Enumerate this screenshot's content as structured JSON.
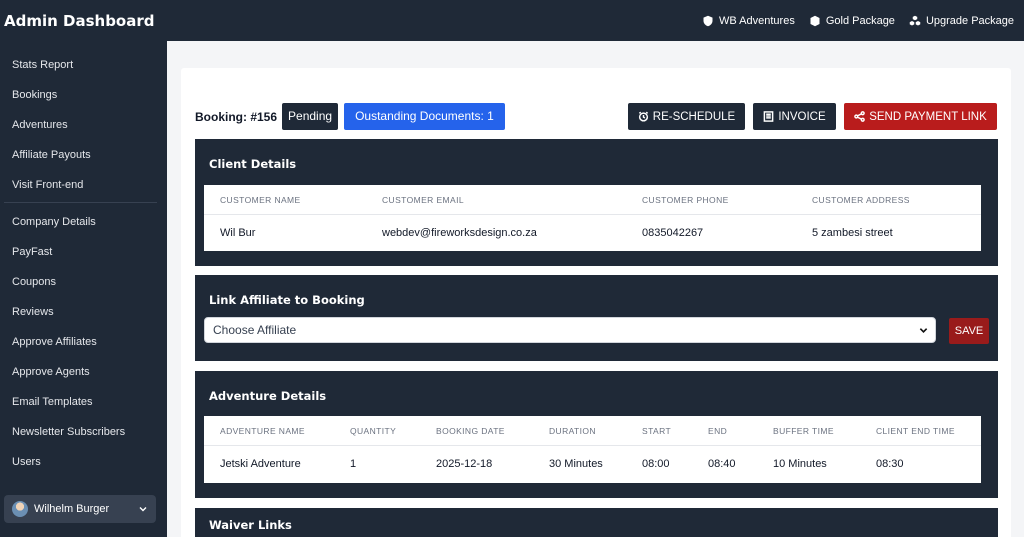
{
  "header": {
    "title": "Admin Dashboard",
    "links": [
      {
        "label": "WB Adventures",
        "icon": "shield-icon"
      },
      {
        "label": "Gold Package",
        "icon": "box-icon"
      },
      {
        "label": "Upgrade Package",
        "icon": "boxes-icon"
      }
    ]
  },
  "sidebar": {
    "group1": [
      "Stats Report",
      "Bookings",
      "Adventures",
      "Affiliate Payouts",
      "Visit Front-end"
    ],
    "group2": [
      "Company Details",
      "PayFast",
      "Coupons",
      "Reviews",
      "Approve Affiliates",
      "Approve Agents",
      "Email Templates",
      "Newsletter Subscribers",
      "Users"
    ],
    "user": "Wilhelm Burger"
  },
  "booking": {
    "label": "Booking: #156",
    "status": "Pending",
    "documents": "Oustanding Documents: 1"
  },
  "actions": {
    "reschedule": "RE-SCHEDULE",
    "invoice": "INVOICE",
    "send_payment": "SEND PAYMENT LINK"
  },
  "client": {
    "title": "Client Details",
    "headers": [
      "CUSTOMER NAME",
      "CUSTOMER EMAIL",
      "CUSTOMER PHONE",
      "CUSTOMER ADDRESS"
    ],
    "row": [
      "Wil Bur",
      "webdev@fireworksdesign.co.za",
      "0835042267",
      "5 zambesi street"
    ]
  },
  "affiliate": {
    "title": "Link Affiliate to Booking",
    "select_value": "Choose Affiliate",
    "save_label": "SAVE"
  },
  "adventure": {
    "title": "Adventure Details",
    "headers": [
      "ADVENTURE NAME",
      "QUANTITY",
      "BOOKING DATE",
      "DURATION",
      "START",
      "END",
      "BUFFER TIME",
      "CLIENT END TIME"
    ],
    "row": [
      "Jetski Adventure",
      "1",
      "2025-12-18",
      "30 Minutes",
      "08:00",
      "08:40",
      "10 Minutes",
      "08:30"
    ]
  },
  "waiver": {
    "title": "Waiver Links"
  },
  "colors": {
    "dark": "#1f2937",
    "primary": "#2563eb",
    "danger": "#b91c1c"
  }
}
